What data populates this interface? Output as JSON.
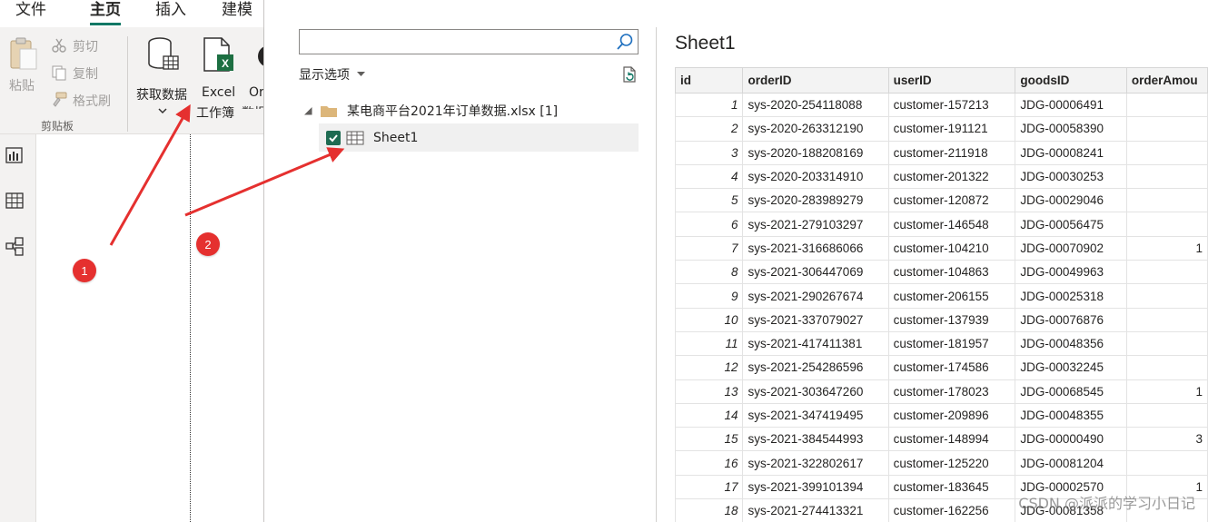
{
  "menu": {
    "tabs": [
      "文件",
      "主页",
      "插入",
      "建模"
    ],
    "active_tab": "主页"
  },
  "ribbon": {
    "paste": "粘贴",
    "cut": "剪切",
    "copy": "复制",
    "format_painter": "格式刷",
    "clipboard_group": "剪贴板",
    "get_data": "获取数据",
    "excel": "Excel",
    "workbook": "工作簿",
    "onelake_partial_1": "Or",
    "onelake_partial_2": "数据"
  },
  "navigator": {
    "search_placeholder": "",
    "display_options": "显示选项",
    "file_node": "某电商平台2021年订单数据.xlsx [1]",
    "sheet_node": "Sheet1",
    "sheet_checked": true
  },
  "preview": {
    "title": "Sheet1",
    "columns": [
      "id",
      "orderID",
      "userID",
      "goodsID",
      "orderAmou"
    ],
    "rows": [
      [
        "1",
        "sys-2020-254118088",
        "customer-157213",
        "JDG-00006491",
        ""
      ],
      [
        "2",
        "sys-2020-263312190",
        "customer-191121",
        "JDG-00058390",
        ""
      ],
      [
        "3",
        "sys-2020-188208169",
        "customer-211918",
        "JDG-00008241",
        ""
      ],
      [
        "4",
        "sys-2020-203314910",
        "customer-201322",
        "JDG-00030253",
        ""
      ],
      [
        "5",
        "sys-2020-283989279",
        "customer-120872",
        "JDG-00029046",
        ""
      ],
      [
        "6",
        "sys-2021-279103297",
        "customer-146548",
        "JDG-00056475",
        ""
      ],
      [
        "7",
        "sys-2021-316686066",
        "customer-104210",
        "JDG-00070902",
        "1"
      ],
      [
        "8",
        "sys-2021-306447069",
        "customer-104863",
        "JDG-00049963",
        ""
      ],
      [
        "9",
        "sys-2021-290267674",
        "customer-206155",
        "JDG-00025318",
        ""
      ],
      [
        "10",
        "sys-2021-337079027",
        "customer-137939",
        "JDG-00076876",
        ""
      ],
      [
        "11",
        "sys-2021-417411381",
        "customer-181957",
        "JDG-00048356",
        ""
      ],
      [
        "12",
        "sys-2021-254286596",
        "customer-174586",
        "JDG-00032245",
        ""
      ],
      [
        "13",
        "sys-2021-303647260",
        "customer-178023",
        "JDG-00068545",
        "1"
      ],
      [
        "14",
        "sys-2021-347419495",
        "customer-209896",
        "JDG-00048355",
        ""
      ],
      [
        "15",
        "sys-2021-384544993",
        "customer-148994",
        "JDG-00000490",
        "3"
      ],
      [
        "16",
        "sys-2021-322802617",
        "customer-125220",
        "JDG-00081204",
        ""
      ],
      [
        "17",
        "sys-2021-399101394",
        "customer-183645",
        "JDG-00002570",
        "1"
      ],
      [
        "18",
        "sys-2021-274413321",
        "customer-162256",
        "JDG-00081358",
        ""
      ]
    ]
  },
  "annotations": {
    "badge_1": "1",
    "badge_2": "2",
    "arrow_color": "#e5302f"
  },
  "watermark": "CSDN @派派的学习小日记",
  "colors": {
    "accent": "#117865",
    "excel_green": "#1d6f42",
    "checkbox": "#1e6b52"
  }
}
